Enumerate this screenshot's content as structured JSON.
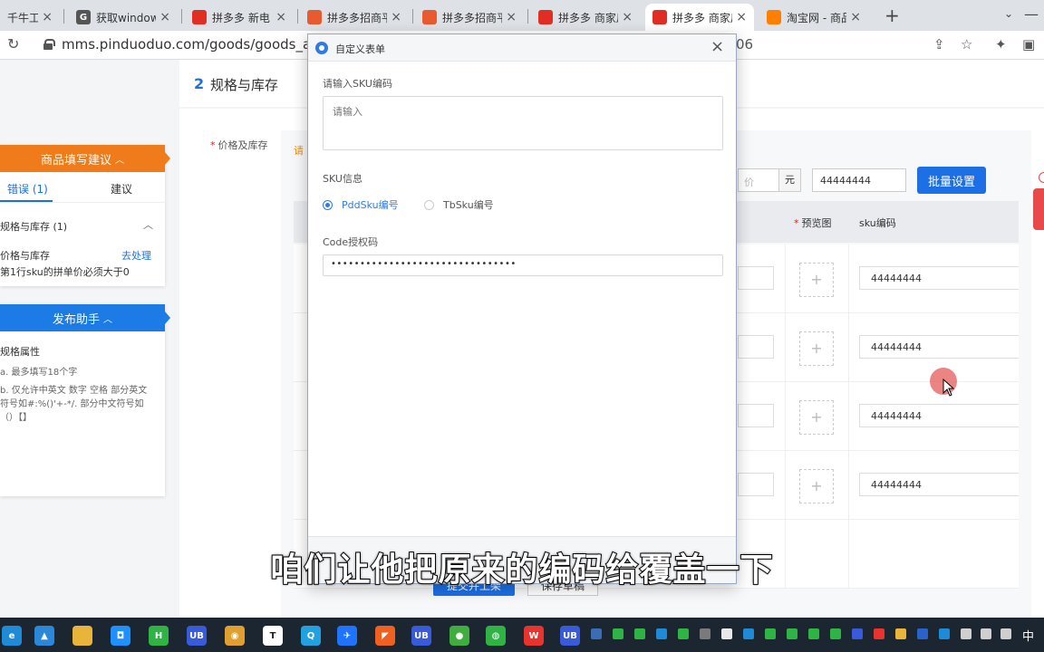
{
  "tabs": [
    {
      "title": "千牛工作",
      "color": "#e8532f",
      "glyph": ""
    },
    {
      "title": "获取window",
      "color": "#555555",
      "glyph": "G"
    },
    {
      "title": "拼多多 新电",
      "color": "#e02e24",
      "glyph": ""
    },
    {
      "title": "拼多多招商平",
      "color": "#e85a2f",
      "glyph": ""
    },
    {
      "title": "拼多多招商平",
      "color": "#e85a2f",
      "glyph": ""
    },
    {
      "title": "拼多多 商家后",
      "color": "#e02e24",
      "glyph": ""
    },
    {
      "title": "拼多多 商家后",
      "color": "#e02e24",
      "glyph": ""
    },
    {
      "title": "淘宝网 - 商品",
      "color": "#ff8000",
      "glyph": ""
    }
  ],
  "tab_close": "×",
  "new_tab": "+",
  "address": {
    "url": "mms.pinduoduo.com/goods/goods_add/in",
    "url_tail": "06"
  },
  "page": {
    "section_number": "2",
    "section_title": "规格与库存",
    "price_stock_label": "价格及库存",
    "required_mark": "*",
    "orange_hint": "请",
    "price_placeholder": "价",
    "unit": "元",
    "batch_sku_value": "44444444",
    "batch_button": "批量设置",
    "col_preview": "预览图",
    "col_sku": "sku编码",
    "add_symbol": "+",
    "rows": [
      {
        "sku": "44444444"
      },
      {
        "sku": "44444444"
      },
      {
        "sku": "44444444"
      },
      {
        "sku": "44444444"
      }
    ],
    "submit_button": "提交并上架",
    "draft_button": "保存草稿"
  },
  "suggest_panel": {
    "title": "商品填写建议",
    "arrow": "^",
    "tab_errors": "错误 (1)",
    "tab_suggest": "建议",
    "group": "规格与库存 (1)",
    "item": "价格与库存",
    "fix_link": "去处理",
    "desc": "第1行sku的拼单价必须大于0"
  },
  "publish_panel": {
    "title": "发布助手",
    "arrow": "^",
    "line1": "规格属性",
    "line2": "a. 最多填写18个字",
    "line3": "b. 仅允许中英文 数字 空格 部分英文符号如#:%()'+-*/. 部分中文符号如（）【】"
  },
  "modal": {
    "title": "自定义表单",
    "close": "×",
    "sku_label": "请输入SKU编码",
    "sku_placeholder": "请输入",
    "info_label": "SKU信息",
    "radio_pdd": "PddSku编号",
    "radio_tb": "TbSku编号",
    "code_label": "Code授权码",
    "code_value": "••••••••••••••••••••••••••••••••"
  },
  "subtitle": "咱们让他把原来的编码给覆盖一下",
  "taskbar": {
    "icons": [
      {
        "name": "edge",
        "color": "#1f8bd6",
        "label": "e"
      },
      {
        "name": "photos",
        "color": "#2b88d8",
        "label": "▲"
      },
      {
        "name": "explorer",
        "color": "#e8b53a",
        "label": ""
      },
      {
        "name": "store",
        "color": "#1e90ff",
        "label": "◘"
      },
      {
        "name": "h-app",
        "color": "#2fb344",
        "label": "H"
      },
      {
        "name": "ub-app",
        "color": "#3a5bd9",
        "label": "UB"
      },
      {
        "name": "chrome",
        "color": "#e0a030",
        "label": "◉"
      },
      {
        "name": "t-app",
        "color": "#ffffff",
        "label": "T"
      },
      {
        "name": "search-app",
        "color": "#23a0e0",
        "label": "Q"
      },
      {
        "name": "feishu",
        "color": "#1f74ff",
        "label": "✈"
      },
      {
        "name": "orange-app",
        "color": "#f06020",
        "label": "◤"
      },
      {
        "name": "ub-app-2",
        "color": "#3a5bd9",
        "label": "UB"
      },
      {
        "name": "green-app",
        "color": "#3fae3f",
        "label": "●"
      },
      {
        "name": "wechat",
        "color": "#2fb344",
        "label": "◍"
      },
      {
        "name": "wps",
        "color": "#e8332f",
        "label": "W"
      },
      {
        "name": "ub-app-3",
        "color": "#3a5bd9",
        "label": "UB"
      }
    ],
    "language": "中"
  }
}
